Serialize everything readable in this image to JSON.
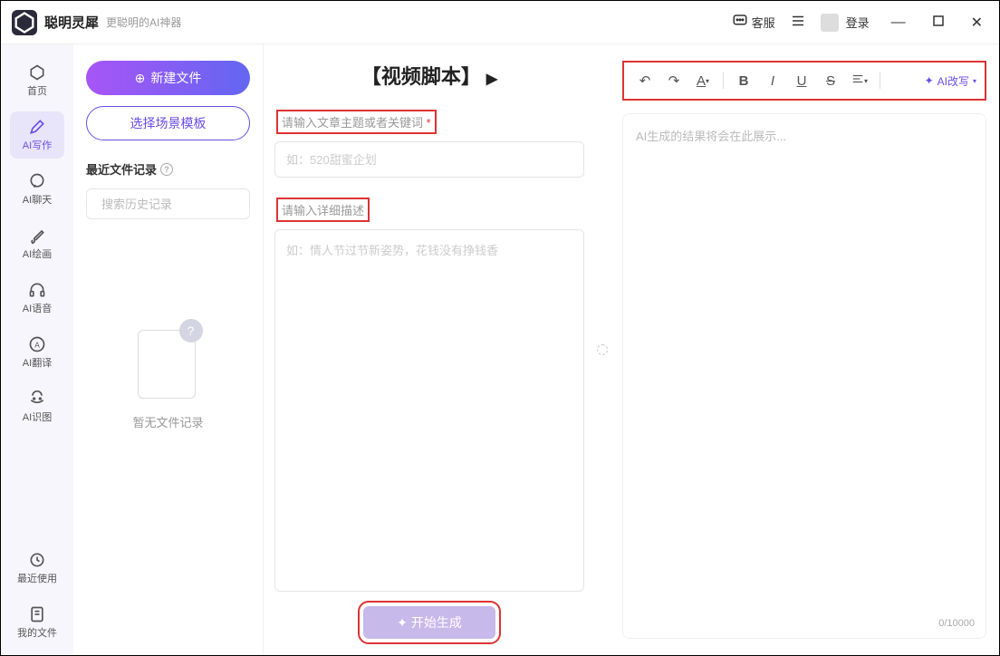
{
  "titlebar": {
    "app_name": "聪明灵犀",
    "app_sub": "更聪明的AI神器",
    "support": "客服",
    "login": "登录"
  },
  "nav": {
    "items": [
      {
        "label": "首页",
        "icon": "home"
      },
      {
        "label": "AI写作",
        "icon": "pen"
      },
      {
        "label": "AI聊天",
        "icon": "chat"
      },
      {
        "label": "AI绘画",
        "icon": "brush"
      },
      {
        "label": "AI语音",
        "icon": "headphone"
      },
      {
        "label": "AI翻译",
        "icon": "translate"
      },
      {
        "label": "AI识图",
        "icon": "image"
      },
      {
        "label": "最近使用",
        "icon": "clock"
      },
      {
        "label": "我的文件",
        "icon": "file"
      }
    ]
  },
  "side": {
    "new_file": "新建文件",
    "select_template": "选择场景模板",
    "recent_title": "最近文件记录",
    "search_placeholder": "搜索历史记录",
    "empty_text": "暂无文件记录"
  },
  "center": {
    "title": "【视频脚本】",
    "label1": "请输入文章主题或者关键词",
    "placeholder1": "如：520甜蜜企划",
    "label2": "请输入详细描述",
    "placeholder2": "如：情人节过节新姿势，花钱没有挣钱香",
    "gen_btn": "开始生成"
  },
  "right": {
    "placeholder": "AI生成的结果将会在此展示...",
    "ai_rewrite": "AI改写",
    "char_count": "0/10000"
  }
}
